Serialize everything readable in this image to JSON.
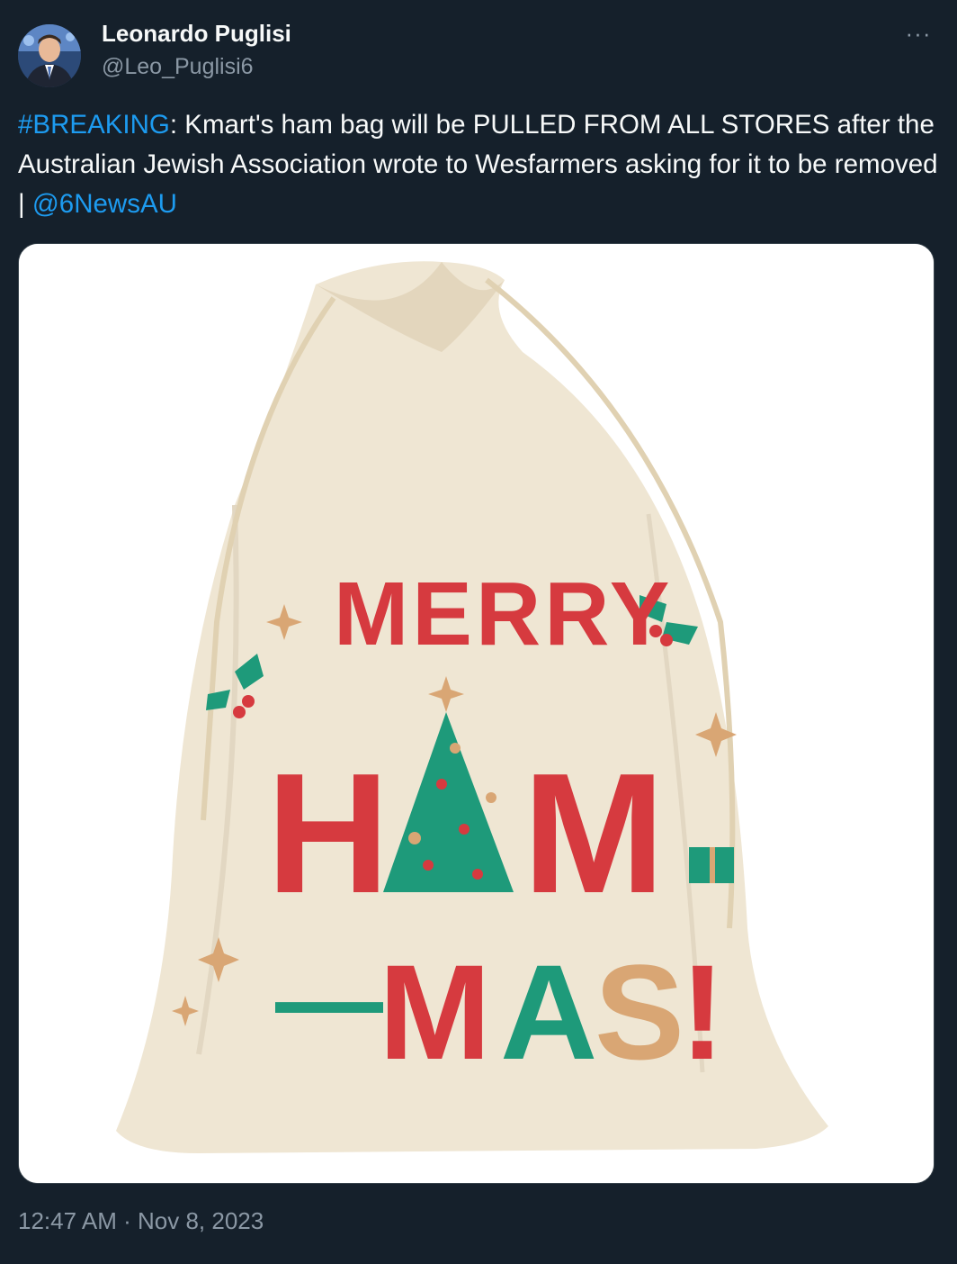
{
  "author": {
    "display_name": "Leonardo Puglisi",
    "handle": "@Leo_Puglisi6"
  },
  "tweet": {
    "hashtag": "#BREAKING",
    "body": ": Kmart's ham bag will be PULLED FROM ALL STORES after the Australian Jewish Association wrote to Wesfarmers asking for it to be removed | ",
    "mention": "@6NewsAU"
  },
  "media": {
    "bag_text": {
      "line1": "MERRY",
      "line2_h": "H",
      "line2_m": "M",
      "line3_dash": "—",
      "line3_m": "M",
      "line3_a": "A",
      "line3_s": "S",
      "line3_excl": "!"
    }
  },
  "meta": {
    "time": "12:47 AM",
    "separator": "·",
    "date": "Nov 8, 2023"
  },
  "more_icon": "more-horizontal-icon",
  "colors": {
    "background": "#15202b",
    "link": "#1d9bf0",
    "secondary_text": "#8b98a5",
    "bag_red": "#d63a3f",
    "bag_green": "#1e9a7a",
    "bag_tan": "#d9a674"
  }
}
